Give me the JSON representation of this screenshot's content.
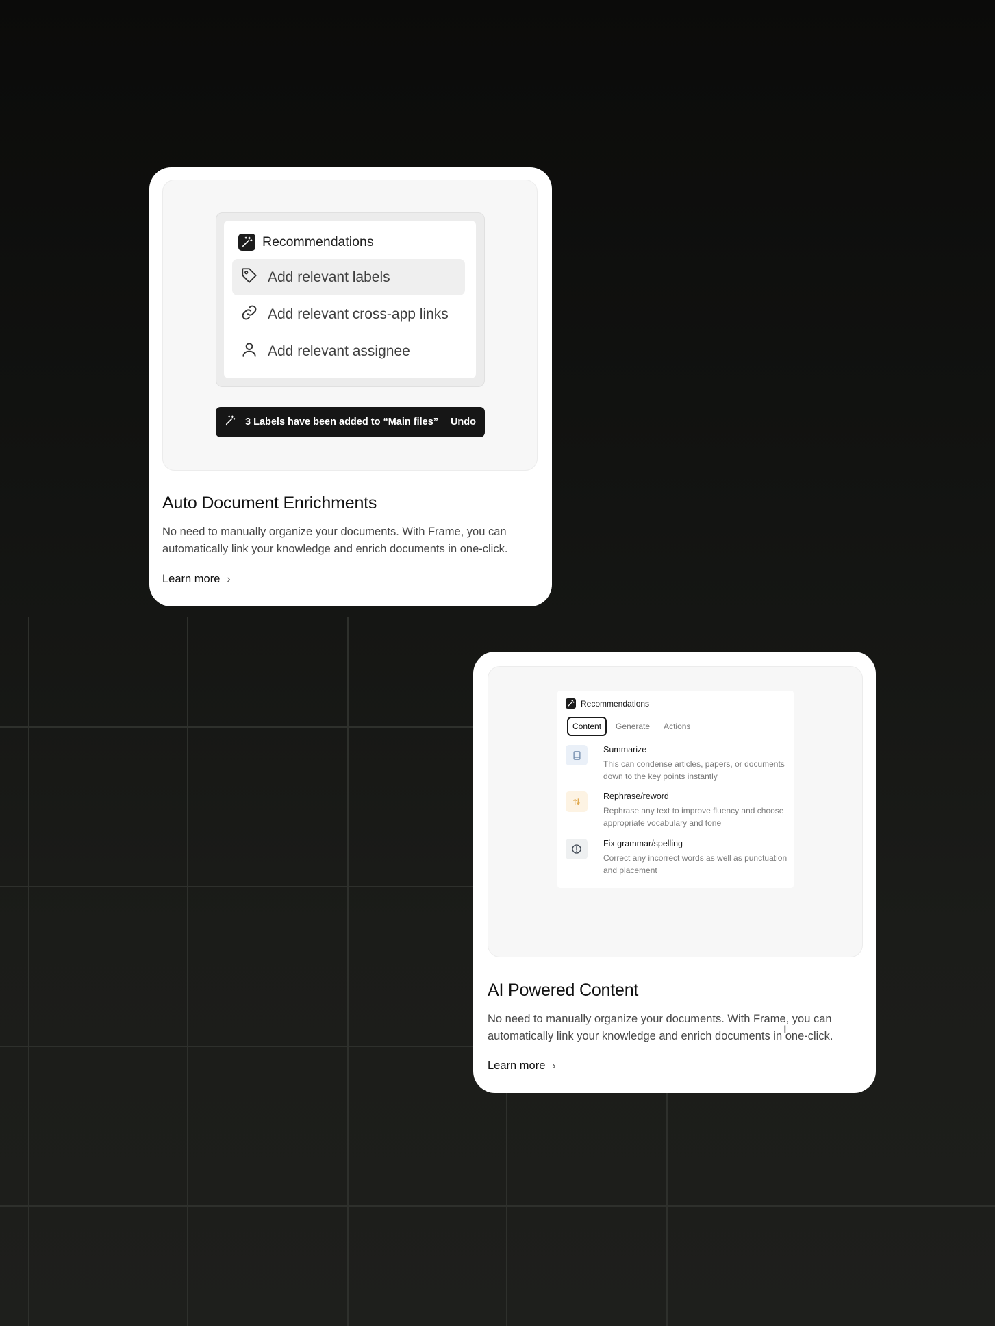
{
  "card1": {
    "panel_title": "Recommendations",
    "items": [
      {
        "label": "Add relevant labels",
        "icon": "tag-icon",
        "active": true
      },
      {
        "label": "Add relevant cross-app links",
        "icon": "link-icon",
        "active": false
      },
      {
        "label": "Add relevant assignee",
        "icon": "user-icon",
        "active": false
      }
    ],
    "toast": {
      "message": "3 Labels have been added to “Main files”",
      "action": "Undo"
    },
    "title": "Auto Document Enrichments",
    "description": "No need to manually organize your documents. With Frame, you can automatically link your knowledge and enrich documents in one-click.",
    "link": "Learn more"
  },
  "card2": {
    "panel_title": "Recommendations",
    "tabs": [
      {
        "label": "Content",
        "active": true
      },
      {
        "label": "Generate",
        "active": false
      },
      {
        "label": "Actions",
        "active": false
      }
    ],
    "options": [
      {
        "title": "Summarize",
        "description": "This can condense articles, papers, or documents down to the key points instantly",
        "icon": "book-icon",
        "icon_bg": "#eaf0f8"
      },
      {
        "title": "Rephrase/reword",
        "description": "Rephrase any text to improve fluency and choose appropriate vocabulary and tone",
        "icon": "swap-arrows-icon",
        "icon_bg": "#fdf3e3"
      },
      {
        "title": "Fix grammar/spelling",
        "description": "Correct any incorrect words as well as punctuation and placement",
        "icon": "alert-circle-icon",
        "icon_bg": "#eef0f1"
      }
    ],
    "title": "AI Powered Content",
    "description": "No need to manually organize your documents. With Frame, you can automatically link your knowledge and enrich documents in one-click.",
    "link": "Learn more"
  }
}
